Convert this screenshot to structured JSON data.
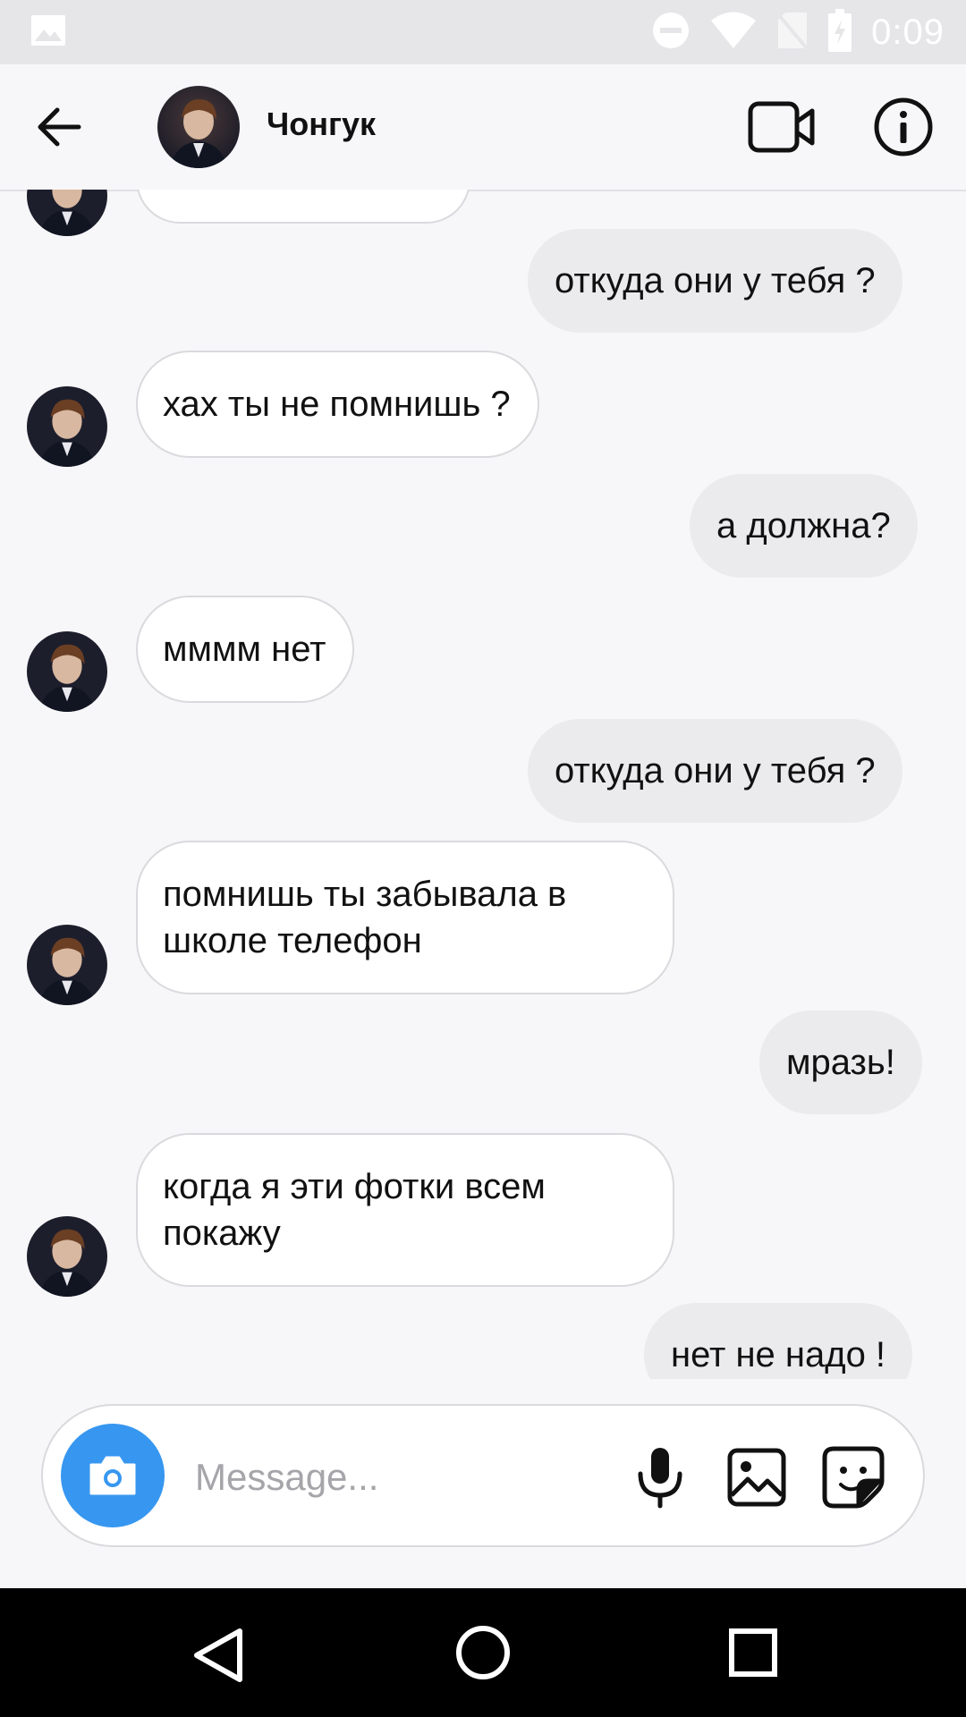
{
  "status_bar": {
    "time": "0:09",
    "icons": [
      "image-icon",
      "do-not-disturb-icon",
      "wifi-icon",
      "no-sim-icon",
      "battery-charging-icon"
    ]
  },
  "header": {
    "contact_name": "Чонгук",
    "back_icon": "arrow-left-icon",
    "video_icon": "video-camera-icon",
    "info_icon": "info-icon"
  },
  "messages": [
    {
      "side": "in",
      "text": ""
    },
    {
      "side": "out",
      "text": "откуда они у тебя ?"
    },
    {
      "side": "in",
      "text": "хах ты не помнишь ?"
    },
    {
      "side": "out",
      "text": "а должна?"
    },
    {
      "side": "in",
      "text": "мммм нет"
    },
    {
      "side": "out",
      "text": "откуда они у тебя ?"
    },
    {
      "side": "in",
      "text": "помнишь ты забывала в школе телефон"
    },
    {
      "side": "out",
      "text": "мразь!"
    },
    {
      "side": "in",
      "text": "когда я эти фотки всем покажу"
    },
    {
      "side": "out",
      "text": "нет не надо !"
    }
  ],
  "composer": {
    "placeholder": "Message...",
    "value": "",
    "accent_color": "#3797f0"
  },
  "nav_bar": {
    "icons": [
      "nav-back-icon",
      "nav-home-icon",
      "nav-recents-icon"
    ]
  }
}
